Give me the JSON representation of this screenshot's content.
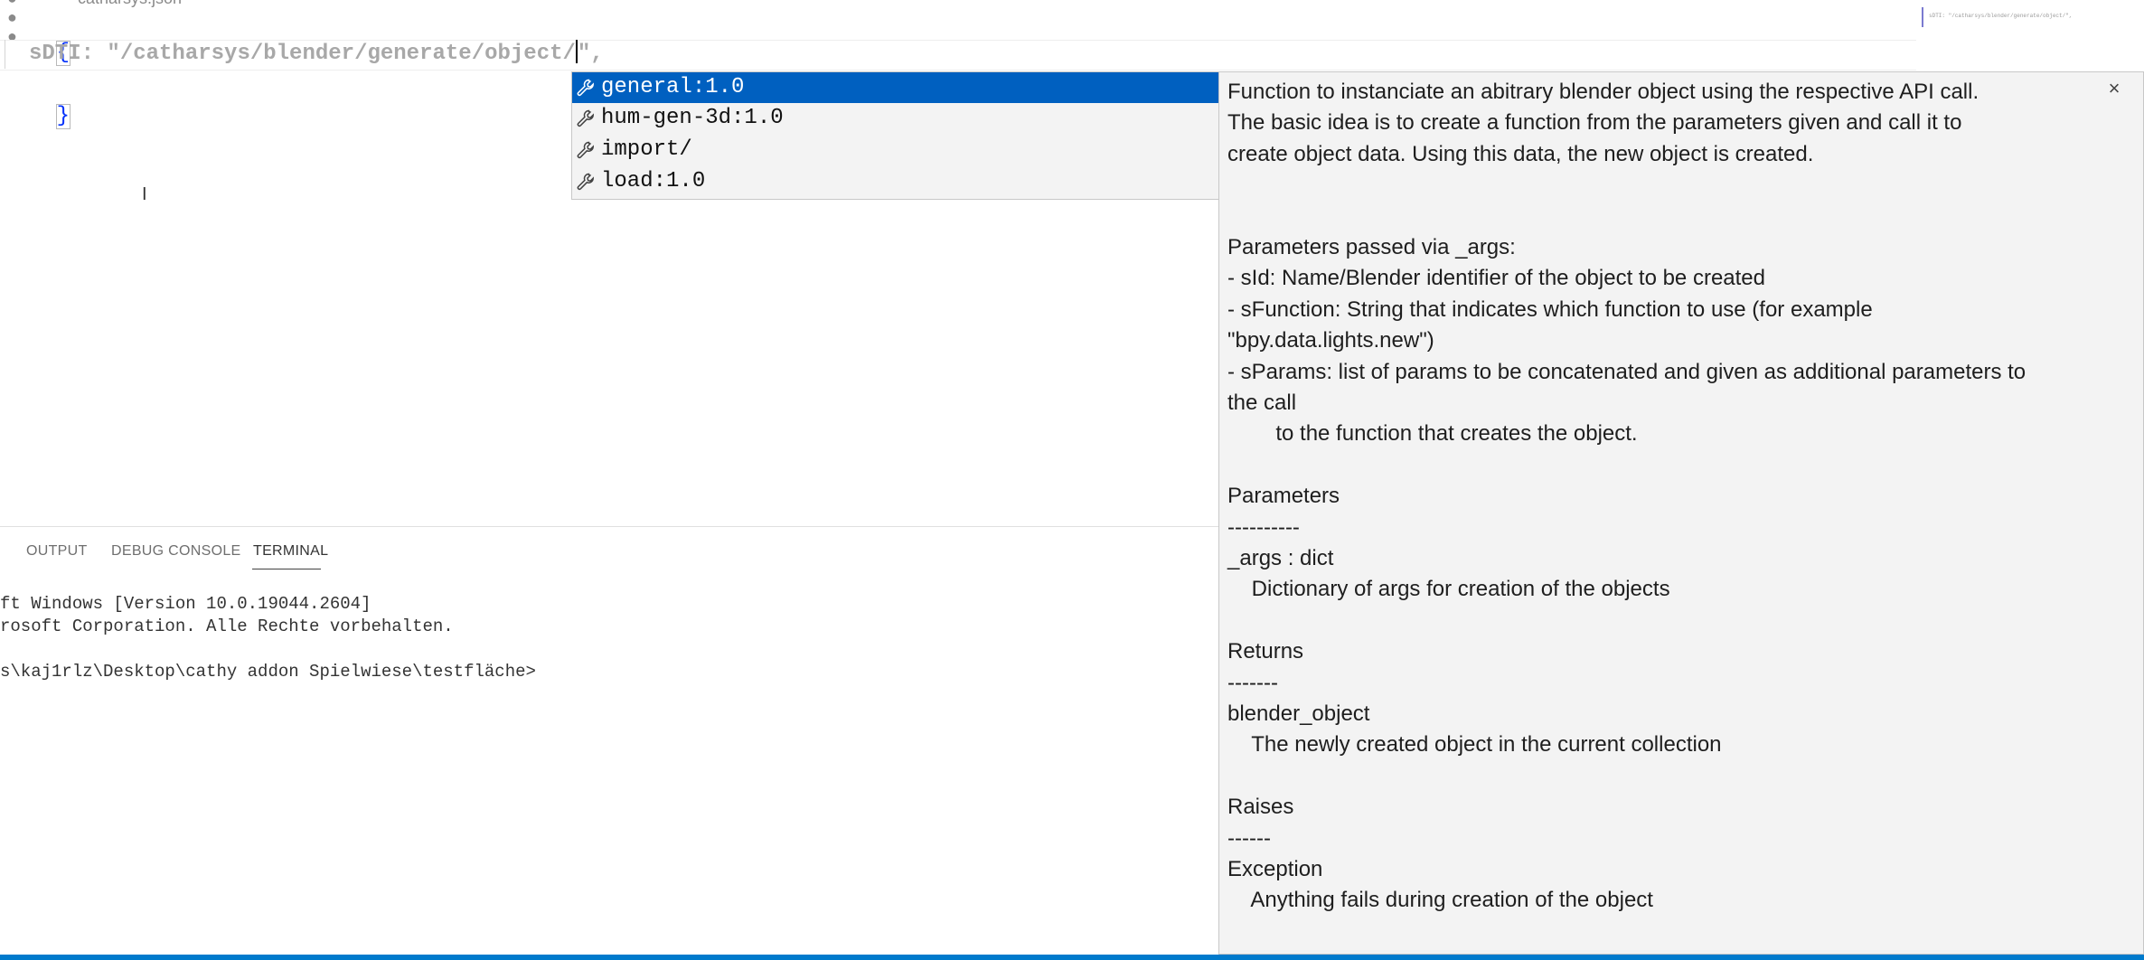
{
  "editor": {
    "tab_filename": "catharsys.json",
    "line1": "{",
    "line2_key": "sDTI: ",
    "line2_value_before_cursor": "\"/catharsys/blender/generate/object/",
    "line2_value_after_cursor": "\",",
    "line3": "}",
    "minimap_text": "sDTI: \"/catharsys/blender/generate/object/\","
  },
  "suggest": {
    "items": [
      {
        "label": "general:1.0",
        "icon": "wrench-icon",
        "selected": true
      },
      {
        "label": "hum-gen-3d:1.0",
        "icon": "wrench-icon",
        "selected": false
      },
      {
        "label": "import/",
        "icon": "wrench-icon",
        "selected": false
      },
      {
        "label": "load:1.0",
        "icon": "wrench-icon",
        "selected": false
      }
    ]
  },
  "details": {
    "close_glyph": "×",
    "lines": [
      "Function to instanciate an abitrary blender object using the respective API call.",
      "The basic idea is to create a function from the parameters given and call it to",
      "create object data. Using this data, the new object is created.",
      "",
      "",
      "Parameters passed via _args:",
      "- sId: Name/Blender identifier of the object to be created",
      "- sFunction: String that indicates which function to use (for example",
      "\"bpy.data.lights.new\")",
      "- sParams: list of params to be concatenated and given as additional parameters to",
      "the call",
      "        to the function that creates the object.",
      "",
      "Parameters",
      "----------",
      "_args : dict",
      "    Dictionary of args for creation of the objects",
      "",
      "Returns",
      "-------",
      "blender_object",
      "    The newly created object in the current collection",
      "",
      "Raises",
      "------",
      "Exception",
      "    Anything fails during creation of the object"
    ]
  },
  "panel": {
    "tabs": [
      {
        "label": "OUTPUT",
        "active": false
      },
      {
        "label": "DEBUG CONSOLE",
        "active": false
      },
      {
        "label": "TERMINAL",
        "active": true
      }
    ],
    "terminal_lines": [
      "ft Windows [Version 10.0.19044.2604]",
      "rosoft Corporation. Alle Rechte vorbehalten.",
      "s\\kaj1rlz\\Desktop\\cathy addon Spielwiese\\testfläche>"
    ]
  },
  "colors": {
    "accent": "#007acc",
    "selection": "#0060c0",
    "brace": "#0431fa",
    "widget_bg": "#f3f3f3"
  }
}
